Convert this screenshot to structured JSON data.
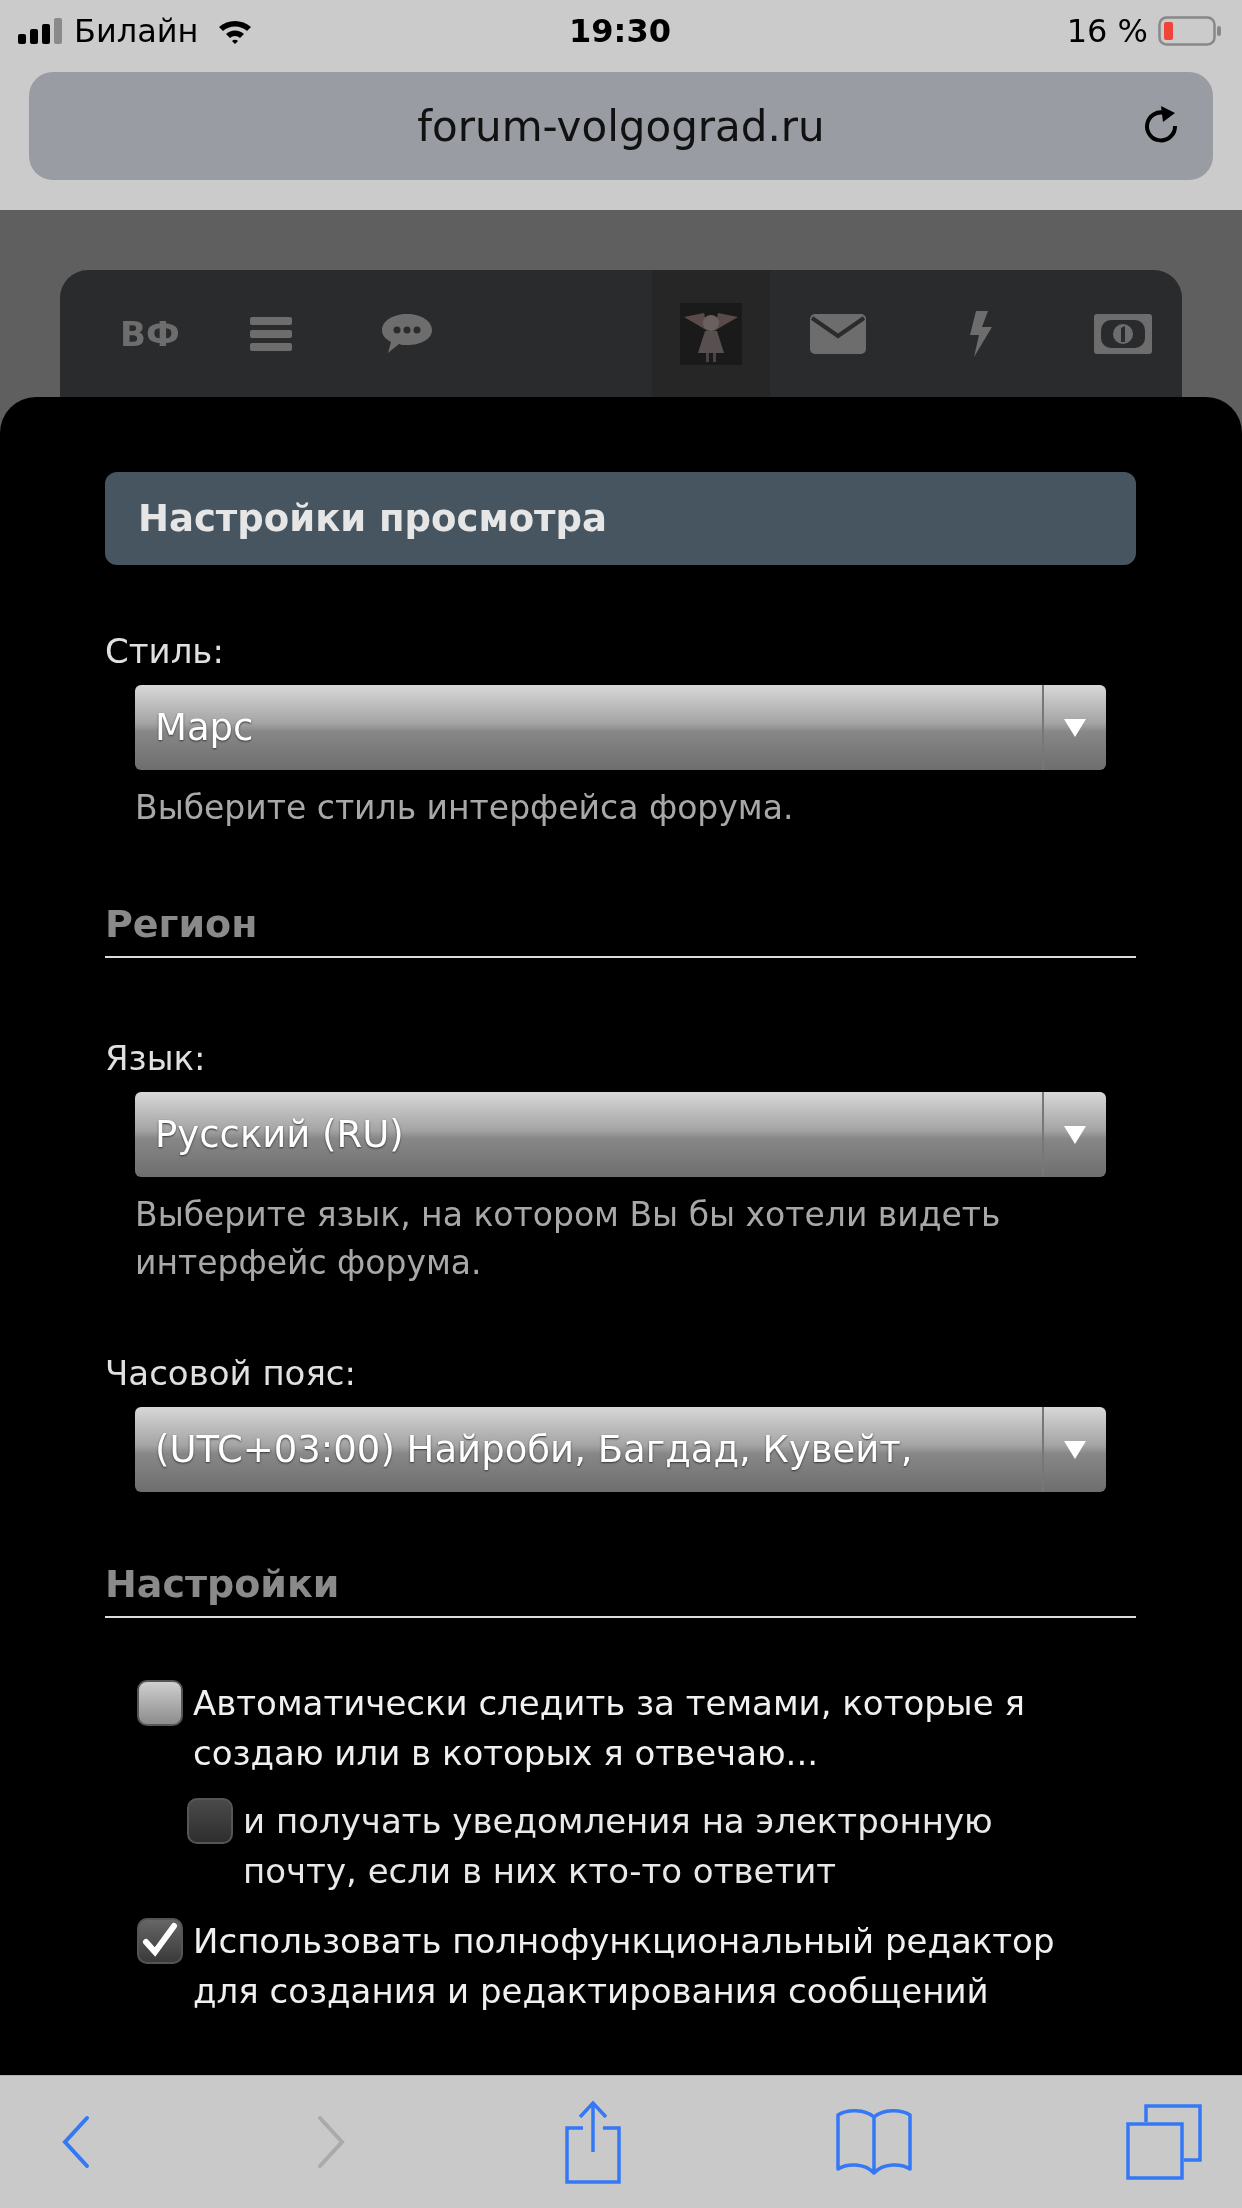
{
  "status_bar": {
    "carrier": "Билайн",
    "time": "19:30",
    "battery": "16 %"
  },
  "url_bar": {
    "url": "forum-volgograd.ru"
  },
  "nav_bar": {
    "logo": "ВФ"
  },
  "panel": {
    "title": "Настройки просмотра",
    "items": [
      {
        "kind": "select",
        "label": "Стиль:",
        "value": "Марс",
        "hint": "Выберите стиль интерфейса форума."
      },
      {
        "kind": "heading",
        "text": "Регион"
      },
      {
        "kind": "select",
        "label": "Язык:",
        "value": "Русский (RU)",
        "hint": "Выберите язык, на котором Вы бы хотели видеть интерфейс форума."
      },
      {
        "kind": "select",
        "label": "Часовой пояс:",
        "value": "(UTC+03:00) Найроби, Багдад, Кувейт,"
      },
      {
        "kind": "heading",
        "text": "Настройки"
      },
      {
        "kind": "checkbox",
        "checked": false,
        "text": "Автоматически следить за темами, которые я создаю или в которых я отвечаю...",
        "children": [
          {
            "kind": "checkbox",
            "checked": false,
            "disabled": true,
            "text": "и получать уведомления на электронную почту, если в них кто-то ответит"
          }
        ]
      },
      {
        "kind": "checkbox",
        "checked": true,
        "text": "Использовать полнофункциональный редактор для создания и редактирования сообщений"
      }
    ]
  }
}
